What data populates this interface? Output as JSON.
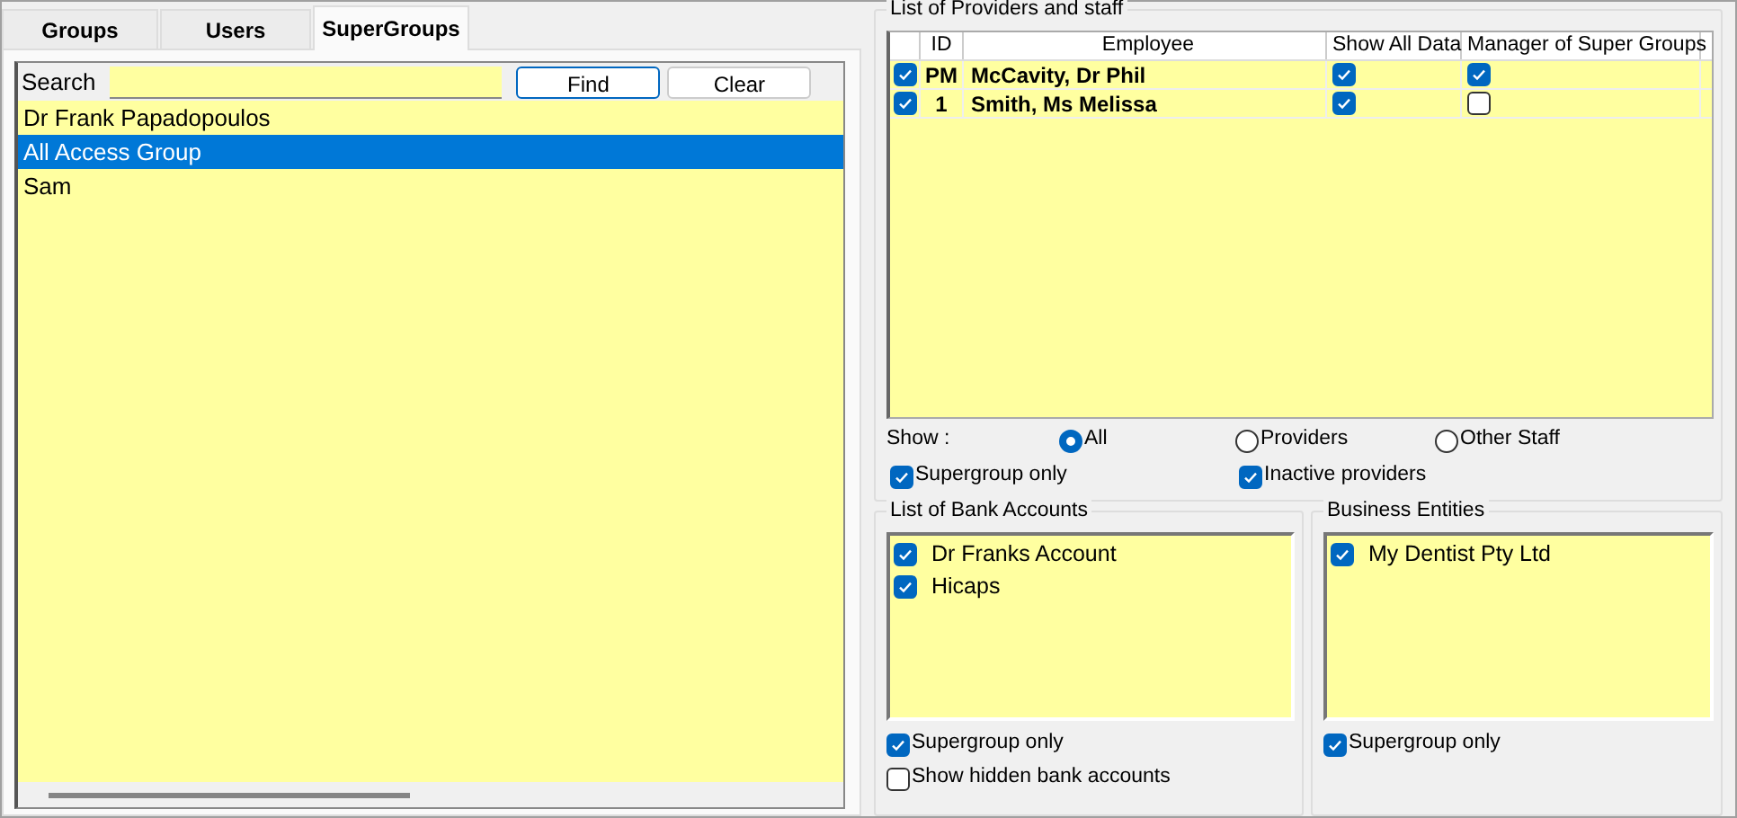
{
  "tabs": [
    {
      "label": "Groups",
      "selected": false
    },
    {
      "label": "Users",
      "selected": false
    },
    {
      "label": "SuperGroups",
      "selected": true
    }
  ],
  "search": {
    "label": "Search",
    "buttons": [
      "Find",
      "Clear"
    ]
  },
  "groups": [
    {
      "name": "Dr Frank Papadopoulos",
      "selected": false
    },
    {
      "name": "All Access Group",
      "selected": true
    },
    {
      "name": "Sam",
      "selected": false
    }
  ],
  "providers": {
    "title": "List of Providers and staff",
    "columns": [
      "ID",
      "Employee",
      "Show All Data",
      "Manager of Super Groups"
    ],
    "rows": [
      {
        "included": true,
        "id": "PM",
        "employee": "McCavity, Dr Phil",
        "show_all_data": true,
        "manager": true
      },
      {
        "included": true,
        "id": "1",
        "employee": "Smith, Ms Melissa",
        "show_all_data": true,
        "manager": false
      }
    ],
    "show_label": "Show :",
    "show_options": [
      {
        "label": "All",
        "selected": true
      },
      {
        "label": "Providers",
        "selected": false
      },
      {
        "label": "Other Staff",
        "selected": false
      }
    ],
    "filters": [
      {
        "label": "Supergroup only",
        "checked": true
      },
      {
        "label": "Inactive providers",
        "checked": true
      }
    ]
  },
  "bank_accounts": {
    "title": "List of Bank Accounts",
    "items": [
      {
        "label": "Dr Franks Account",
        "checked": true
      },
      {
        "label": "Hicaps",
        "checked": true
      }
    ],
    "options": [
      {
        "label": "Supergroup only",
        "checked": true
      },
      {
        "label": "Show hidden bank accounts",
        "checked": false
      }
    ]
  },
  "business_entities": {
    "title": "Business Entities",
    "items": [
      {
        "label": "My Dentist Pty Ltd",
        "checked": true
      }
    ],
    "options": [
      {
        "label": "Supergroup only",
        "checked": true
      }
    ]
  }
}
